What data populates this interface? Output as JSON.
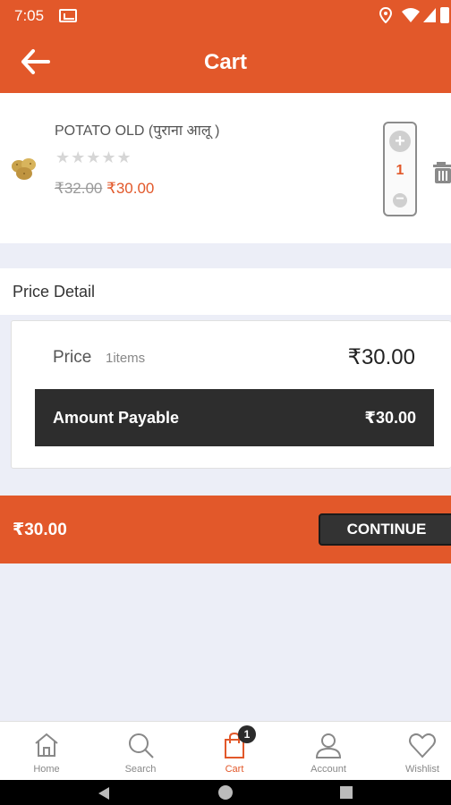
{
  "status_bar": {
    "time": "7:05"
  },
  "app_bar": {
    "title": "Cart"
  },
  "cart_item": {
    "name": "POTATO OLD (पुराना आलू )",
    "rating_stars": "★★★★★",
    "rating_value": 0,
    "mrp": "₹32.00",
    "price": "₹30.00",
    "quantity": "1"
  },
  "price_detail": {
    "header": "Price Detail",
    "price_label": "Price",
    "item_count": "1items",
    "price_value": "₹30.00",
    "amount_payable_label": "Amount Payable",
    "amount_payable_value": "₹30.00"
  },
  "checkout": {
    "total": "₹30.00",
    "continue_label": "CONTINUE"
  },
  "bottom_nav": {
    "tabs": [
      {
        "label": "Home",
        "icon": "home-icon"
      },
      {
        "label": "Search",
        "icon": "search-icon"
      },
      {
        "label": "Cart",
        "icon": "cart-bag-icon",
        "badge": "1",
        "active": true
      },
      {
        "label": "Account",
        "icon": "account-icon"
      },
      {
        "label": "Wishlist",
        "icon": "heart-icon"
      }
    ]
  },
  "colors": {
    "brand": "#e2582a",
    "dark": "#2d2d2d",
    "background": "#eceef7"
  }
}
